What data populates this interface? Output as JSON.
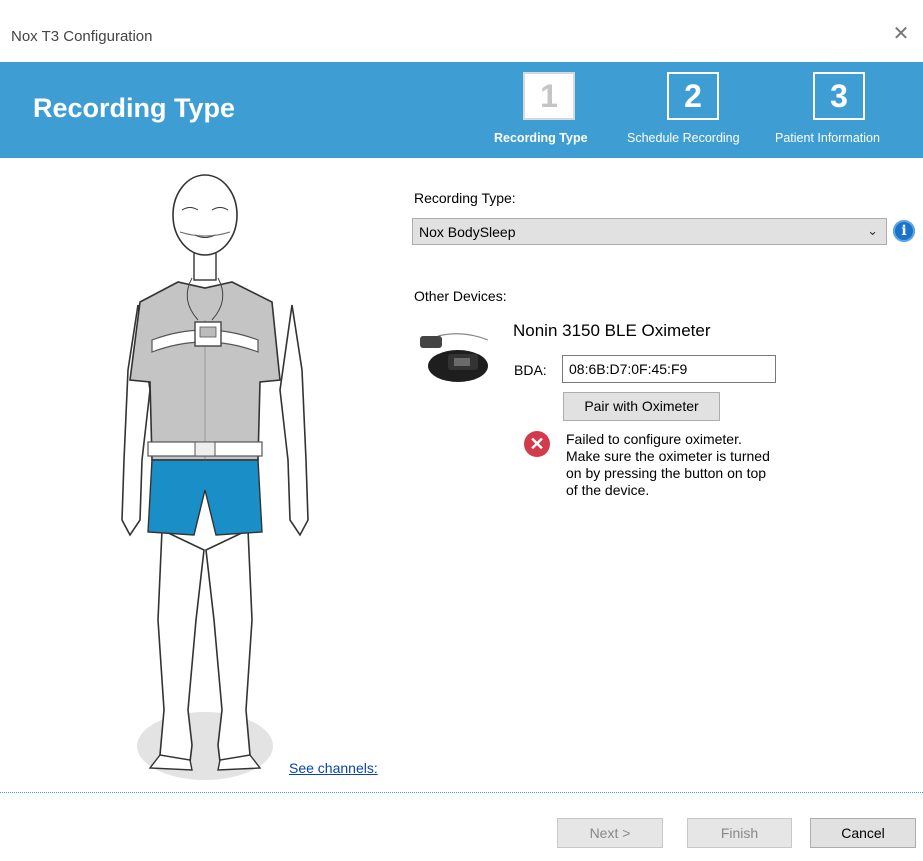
{
  "window": {
    "title": "Nox T3 Configuration",
    "close_glyph": "✕"
  },
  "banner": {
    "title": "Recording Type",
    "steps": [
      {
        "number": "1",
        "label": "Recording Type",
        "active": true
      },
      {
        "number": "2",
        "label": "Schedule Recording",
        "active": false
      },
      {
        "number": "3",
        "label": "Patient Information",
        "active": false
      }
    ]
  },
  "left": {
    "see_channels": "See channels:"
  },
  "form": {
    "recording_type_label": "Recording Type:",
    "recording_type_value": "Nox BodySleep",
    "caret": "⌄",
    "info_glyph": "i",
    "other_devices_label": "Other Devices:",
    "device_name": "Nonin 3150 BLE Oximeter",
    "bda_label": "BDA:",
    "bda_value": "08:6B:D7:0F:45:F9",
    "pair_button": "Pair with Oximeter",
    "error_glyph": "✕",
    "error_lines": [
      "Failed to configure oximeter.",
      "Make sure the oximeter is turned",
      "on by pressing the button on top",
      "of the device."
    ]
  },
  "footer": {
    "next": "Next >",
    "finish": "Finish",
    "cancel": "Cancel"
  },
  "colors": {
    "accent": "#3e9ed3",
    "error": "#d23b4c",
    "shorts": "#1a8fc7",
    "shirt": "#c4c4c4"
  }
}
